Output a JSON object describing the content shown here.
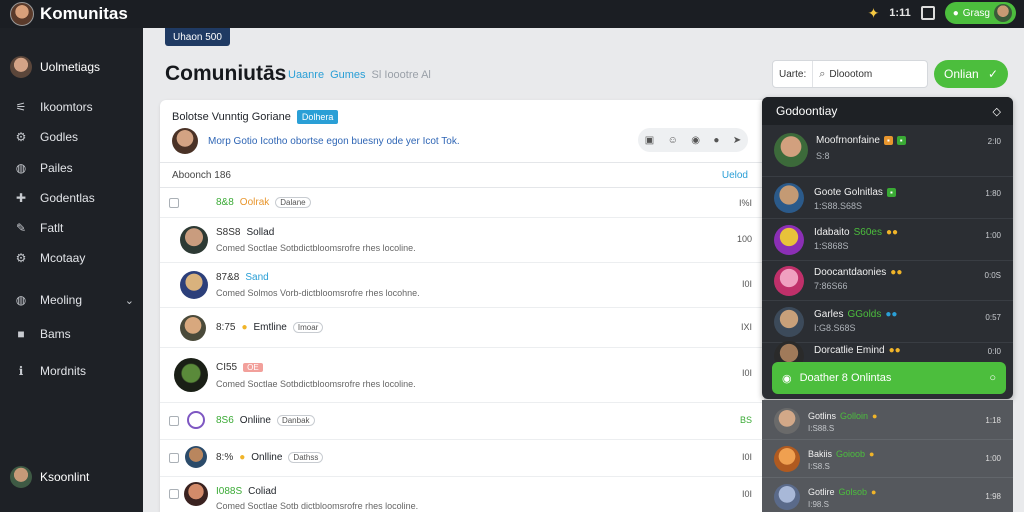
{
  "topbar": {
    "title": "Komunitas",
    "count": "1:11",
    "pill_label": "Grasg"
  },
  "sidebar": {
    "user": "Uolmetiags",
    "items": [
      {
        "label": "Ikoomtors",
        "icon": "share-icon"
      },
      {
        "label": "Godles",
        "icon": "gear-icon"
      },
      {
        "label": "Pailes",
        "icon": "globe-icon"
      },
      {
        "label": "Godentlas",
        "icon": "puzzle-icon"
      },
      {
        "label": "Fatlt",
        "icon": "pencil-icon"
      },
      {
        "label": "Mcotaay",
        "icon": "gear-icon"
      },
      {
        "label": "Meoling",
        "icon": "globe-icon"
      },
      {
        "label": "Bams",
        "icon": "square-icon"
      },
      {
        "label": "Mordnits",
        "icon": "info-icon"
      }
    ],
    "bottom_user": "Ksoonlint"
  },
  "header": {
    "breadcrumb": "Uhaon 500",
    "title": "Comuniutās",
    "sub1": "Uaanre",
    "sub2": "Gumes",
    "sub3": "Sl Ioootre Al",
    "sort_label": "Uarte:",
    "sort_value": "Dloootom",
    "online_button": "Onlian"
  },
  "card": {
    "header": "Bolotse Vunntig Goriane",
    "badge": "Dolhera",
    "compose": "Morp Gotio Icotho obortse egon buesny ode yer Icot Tok.",
    "list_header": "Aboonch 186",
    "list_header_right": "Uelod"
  },
  "rows": [
    {
      "num": "8&8",
      "name": "Oolrak",
      "name_color": "orange",
      "tag": "Dalane",
      "desc": "",
      "count": "I%I",
      "check": true
    },
    {
      "num": "S8S8",
      "name": "Sollad",
      "name_color": "default",
      "tag": "",
      "desc": "Comed Soctlae Sotbdictbloomsrofre rhes locoline.",
      "count": "100"
    },
    {
      "num": "87&8",
      "name": "Sand",
      "name_color": "blue",
      "tag": "",
      "desc": "Comed Solmos Vorb-dictbloomsrofre rhes locohne.",
      "count": "I0I"
    },
    {
      "num": "8:75",
      "name": "Emtline",
      "name_color": "default",
      "tag": "Imoar",
      "desc": "",
      "count": "IXI"
    },
    {
      "num": "CI55",
      "name": "OE",
      "name_color": "default",
      "tag": "",
      "redtag": "OE",
      "desc": "Comed Soctlae Sotbdictbloomsrofre rhes locoline.",
      "count": "I0I"
    },
    {
      "num": "8S6",
      "name": "Onliine",
      "name_color": "default",
      "tag": "Danbak",
      "desc": "",
      "count": "BS",
      "check": true
    },
    {
      "num": "8:%",
      "name": "Onlline",
      "name_color": "default",
      "tag": "Dathss",
      "desc": "",
      "count": "I0I",
      "check": true
    },
    {
      "num": "I088S",
      "name": "Coliad",
      "name_color": "default",
      "tag": "",
      "desc": "Comed Soctlae Sotb dictbloomsrofre rhes locoline.",
      "count": "I0I",
      "check": true
    }
  ],
  "panel": {
    "title": "Godoontiay",
    "online_label": "Doather 8 Onlintas",
    "users": [
      {
        "name": "Moofrnonfaine",
        "sub": "S:8",
        "count": "2:I0"
      },
      {
        "name": "Goote Golnitlas",
        "sub": "1:S88.S68S",
        "count": "1:80"
      },
      {
        "name": "Idabaito",
        "green": "S60es",
        "sub": "1:S868S",
        "count": "1:00"
      },
      {
        "name": "Doocantdaonies",
        "sub": "7:86S66",
        "count": "0:0S"
      },
      {
        "name": "Garles",
        "green": "GGolds",
        "sub": "I:G8.S68S",
        "count": "0:57"
      },
      {
        "name": "Dorcatlie Emind",
        "sub": "",
        "count": "0:I0"
      }
    ],
    "lower": [
      {
        "name": "Gotlins",
        "green": "Golloin",
        "sub": "I:S88.S",
        "count": "1:18"
      },
      {
        "name": "Bakiis",
        "green": "Goioob",
        "sub": "I:S8.S",
        "count": "1:00"
      },
      {
        "name": "Gotlire",
        "green": "Golsob",
        "sub": "I:98.S",
        "count": "1:98"
      }
    ]
  },
  "colors": {
    "accent_green": "#4cbe3d",
    "accent_blue": "#2a9fd6",
    "orange": "#e8962e"
  }
}
